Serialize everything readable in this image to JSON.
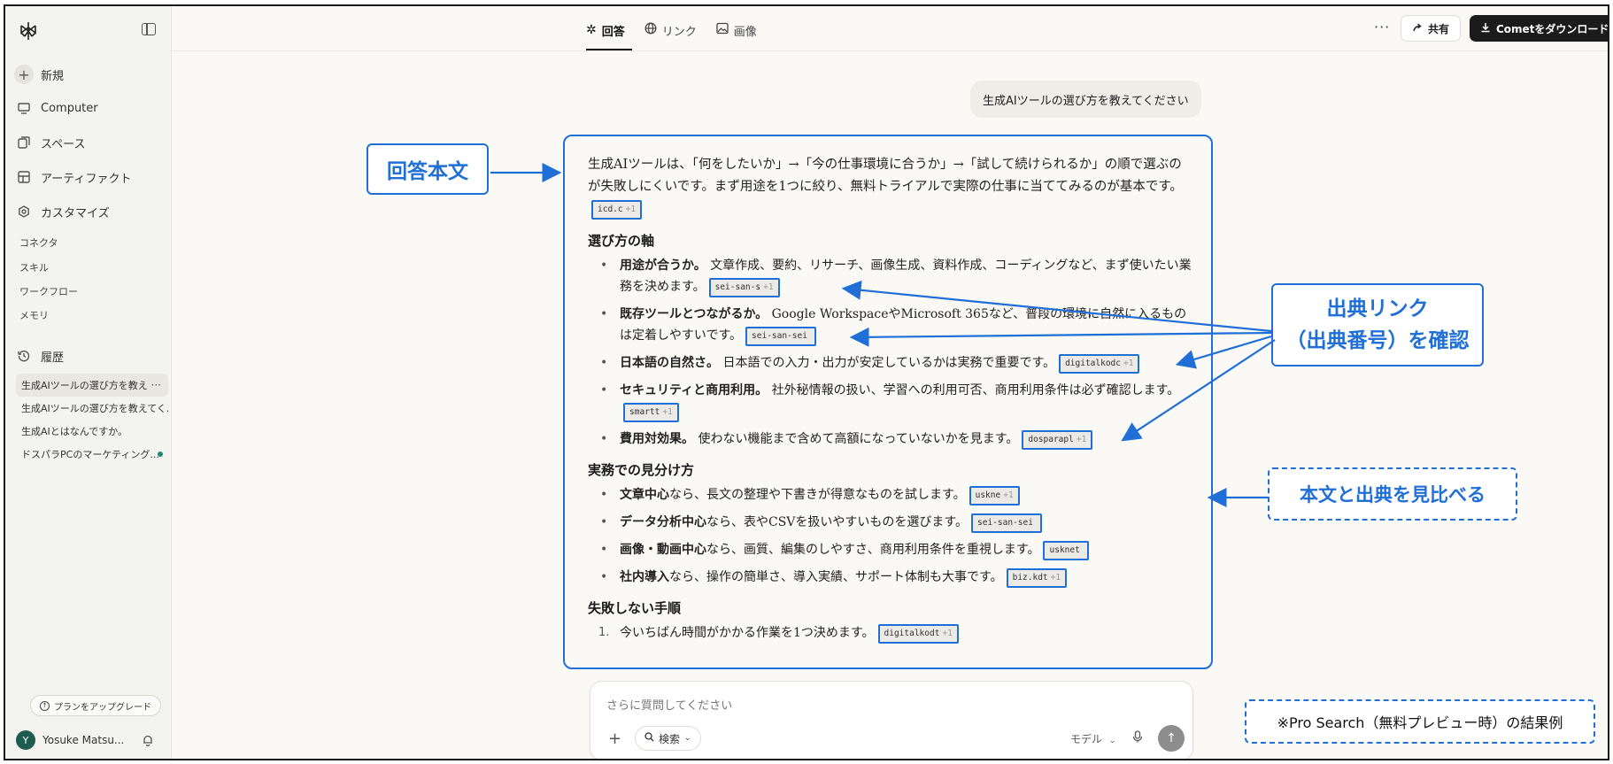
{
  "sidebar": {
    "nav": [
      {
        "label": "新規",
        "icon": "plus-icon"
      },
      {
        "label": "Computer",
        "icon": "computer-icon"
      },
      {
        "label": "スペース",
        "icon": "spaces-icon"
      },
      {
        "label": "アーティファクト",
        "icon": "artifact-icon"
      },
      {
        "label": "カスタマイズ",
        "icon": "customize-icon"
      }
    ],
    "sub_items": [
      "コネクタ",
      "スキル",
      "ワークフロー",
      "メモリ"
    ],
    "history_label": "履歴",
    "history": [
      {
        "label": "生成AIツールの選び方を教え"
      },
      {
        "label": "生成AIツールの選び方を教えてく..."
      },
      {
        "label": "生成AIとはなんですか。"
      },
      {
        "label": "ドスパラPCのマーケティング..."
      }
    ],
    "upgrade_label": "プランをアップグレード",
    "user_initial": "Y",
    "user_name": "Yosuke Matsu..."
  },
  "tabs": [
    {
      "label": "回答",
      "icon": "answer-icon"
    },
    {
      "label": "リンク",
      "icon": "globe-icon"
    },
    {
      "label": "画像",
      "icon": "image-icon"
    }
  ],
  "header": {
    "more": "···",
    "share_label": "共有",
    "download_label": "Cometをダウンロード"
  },
  "question": "生成AIツールの選び方を教えてください",
  "answer": {
    "intro": "生成AIツールは、「何をしたいか」→「今の仕事環境に合うか」→「試して続けられるか」の順で選ぶのが失敗しにくいです。まず用途を1つに絞り、無料トライアルで実際の仕事に当ててみるのが基本です。",
    "intro_cite": "icd.c",
    "sections": [
      {
        "heading": "選び方の軸",
        "items": [
          {
            "bold": "用途が合うか。",
            "text": " 文章作成、要約、リサーチ、画像生成、資料作成、コーディングなど、まず使いたい業務を決めます。",
            "cite": "sei-san-s",
            "plus": "+1"
          },
          {
            "bold": "既存ツールとつながるか。",
            "text": " Google WorkspaceやMicrosoft 365など、普段の環境に自然に入るものは定着しやすいです。",
            "cite": "sei-san-sei",
            "plus": ""
          },
          {
            "bold": "日本語の自然さ。",
            "text": " 日本語での入力・出力が安定しているかは実務で重要です。",
            "cite": "digitalkodc",
            "plus": "+1"
          },
          {
            "bold": "セキュリティと商用利用。",
            "text": " 社外秘情報の扱い、学習への利用可否、商用利用条件は必ず確認します。",
            "cite": "smartt",
            "plus": "+1"
          },
          {
            "bold": "費用対効果。",
            "text": " 使わない機能まで含めて高額になっていないかを見ます。",
            "cite": "dosparapl",
            "plus": "+1"
          }
        ]
      },
      {
        "heading": "実務での見分け方",
        "items": [
          {
            "bold": "文章中心",
            "text": "なら、長文の整理や下書きが得意なものを試します。",
            "cite": "uskne",
            "plus": "+1"
          },
          {
            "bold": "データ分析中心",
            "text": "なら、表やCSVを扱いやすいものを選びます。",
            "cite": "sei-san-sei",
            "plus": ""
          },
          {
            "bold": "画像・動画中心",
            "text": "なら、画質、編集のしやすさ、商用利用条件を重視します。",
            "cite": "usknet",
            "plus": ""
          },
          {
            "bold": "社内導入",
            "text": "なら、操作の簡単さ、導入実績、サポート体制も大事です。",
            "cite": "biz.kdt",
            "plus": "+1"
          }
        ]
      }
    ],
    "steps_heading": "失敗しない手順",
    "steps": [
      {
        "num": "1.",
        "text": "今いちばん時間がかかる作業を1つ決めます。",
        "cite": "digitalkodt",
        "plus": "+1"
      }
    ]
  },
  "annotations": {
    "body_label": "回答本文",
    "source_line1": "出典リンク",
    "source_line2": "（出典番号）を確認",
    "compare_label": "本文と出典を見比べる",
    "note": "※Pro Search（無料プレビュー時）の結果例"
  },
  "input": {
    "placeholder": "さらに質問してください",
    "search_label": "検索",
    "model_label": "モデル"
  },
  "colors": {
    "annotation_blue": "#1f6fd6",
    "sidebar_bg": "#f3f3ef",
    "page_bg": "#faf9f6"
  }
}
